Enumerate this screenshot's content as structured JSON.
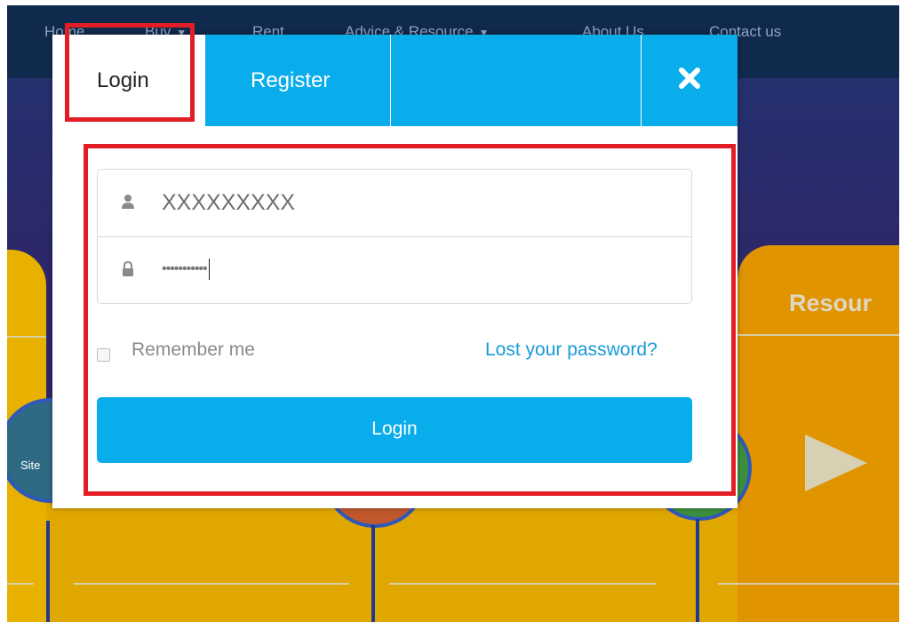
{
  "nav": {
    "items": [
      {
        "label": "Home"
      },
      {
        "label": "Buy"
      },
      {
        "label": "Rent"
      },
      {
        "label": "Advice & Resource"
      },
      {
        "label": "About Us"
      },
      {
        "label": "Contact us"
      }
    ],
    "caret": "▼"
  },
  "background": {
    "site_label": "Site",
    "resource_label": "Resour"
  },
  "modal": {
    "tabs": {
      "login": "Login",
      "register": "Register"
    },
    "close_icon": "close-icon",
    "username": {
      "value": "XXXXXXXXX",
      "icon": "user-icon"
    },
    "password": {
      "value": "•••••••••••",
      "icon": "lock-icon"
    },
    "remember_label": "Remember me",
    "remember_checked": false,
    "lost_password": "Lost your password?",
    "login_button": "Login"
  },
  "colors": {
    "accent": "#0aadec",
    "highlight": "#e31d25",
    "link": "#1a9ad8"
  }
}
